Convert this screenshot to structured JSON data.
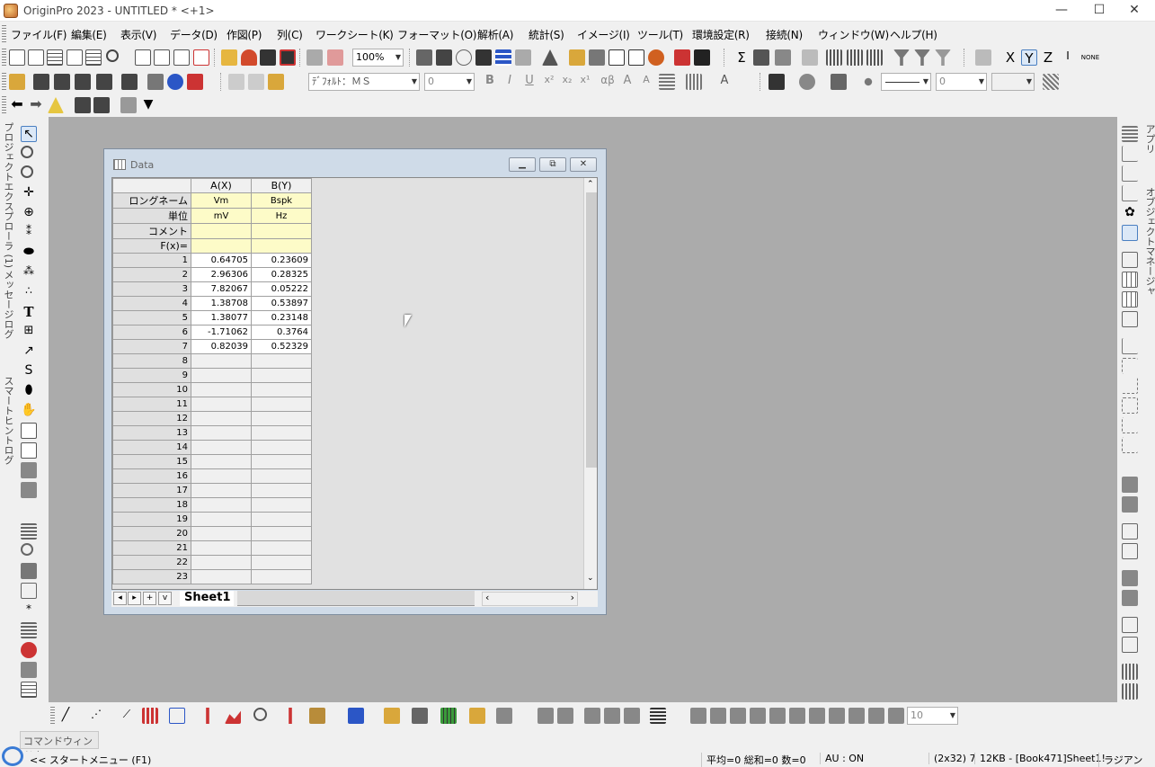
{
  "app": {
    "title": "OriginPro 2023 - UNTITLED * <+1>"
  },
  "window_controls": {
    "minimize": "—",
    "maximize": "☐",
    "close": "✕"
  },
  "menu": [
    "ファイル(F)",
    "編集(E)",
    "表示(V)",
    "データ(D)",
    "作図(P)",
    "列(C)",
    "ワークシート(K)",
    "フォーマット(O)",
    "解析(A)",
    "統計(S)",
    "イメージ(I)",
    "ツール(T)",
    "環境設定(R)",
    "接続(N)",
    "ウィンドウ(W)",
    "ヘルプ(H)"
  ],
  "toolbar": {
    "zoom": "100%",
    "font": "ﾃﾞﾌｫﾙﾄ：ＭＳ",
    "font_size": "0",
    "line_width": "0",
    "bottom_size": "10"
  },
  "side_labels": {
    "project_explorer": "プロジェクトエクスプローラ (1)",
    "messages": "メッセージログ",
    "smart_hint": "スマートヒントログ",
    "apps": "アプリ",
    "object_manager": "オブジェクトマネージャ"
  },
  "datawin": {
    "title": "Data"
  },
  "worksheet": {
    "col_headers": [
      "A(X)",
      "B(Y)"
    ],
    "meta_rows": [
      {
        "label": "ロングネーム",
        "a": "Vm",
        "b": "Bspk"
      },
      {
        "label": "単位",
        "a": "mV",
        "b": "Hz"
      },
      {
        "label": "コメント",
        "a": "",
        "b": ""
      },
      {
        "label": "F(x)=",
        "a": "",
        "b": ""
      }
    ],
    "rows": [
      {
        "n": "1",
        "a": "0.64705",
        "b": "0.23609"
      },
      {
        "n": "2",
        "a": "2.96306",
        "b": "0.28325"
      },
      {
        "n": "3",
        "a": "7.82067",
        "b": "0.05222"
      },
      {
        "n": "4",
        "a": "1.38708",
        "b": "0.53897"
      },
      {
        "n": "5",
        "a": "1.38077",
        "b": "0.23148"
      },
      {
        "n": "6",
        "a": "-1.71062",
        "b": "0.3764"
      },
      {
        "n": "7",
        "a": "0.82039",
        "b": "0.52329"
      },
      {
        "n": "8",
        "a": "",
        "b": ""
      },
      {
        "n": "9",
        "a": "",
        "b": ""
      },
      {
        "n": "10",
        "a": "",
        "b": ""
      },
      {
        "n": "11",
        "a": "",
        "b": ""
      },
      {
        "n": "12",
        "a": "",
        "b": ""
      },
      {
        "n": "13",
        "a": "",
        "b": ""
      },
      {
        "n": "14",
        "a": "",
        "b": ""
      },
      {
        "n": "15",
        "a": "",
        "b": ""
      },
      {
        "n": "16",
        "a": "",
        "b": ""
      },
      {
        "n": "17",
        "a": "",
        "b": ""
      },
      {
        "n": "18",
        "a": "",
        "b": ""
      },
      {
        "n": "19",
        "a": "",
        "b": ""
      },
      {
        "n": "20",
        "a": "",
        "b": ""
      },
      {
        "n": "21",
        "a": "",
        "b": ""
      },
      {
        "n": "22",
        "a": "",
        "b": ""
      },
      {
        "n": "23",
        "a": "",
        "b": ""
      }
    ],
    "sheet_tab": "Sheet1",
    "nav": [
      "|<",
      "<",
      "+",
      "V"
    ]
  },
  "cmd": {
    "tab": "コマンドウィンドウ",
    "start": "<< スタートメニュー (F1)"
  },
  "status": {
    "stats": "平均=0 総和=0 数=0",
    "au": "AU : ON",
    "dims": "(2x32) 7",
    "size": "12KB - [Book471]Sheet1!",
    "unit": "ラジアン"
  }
}
